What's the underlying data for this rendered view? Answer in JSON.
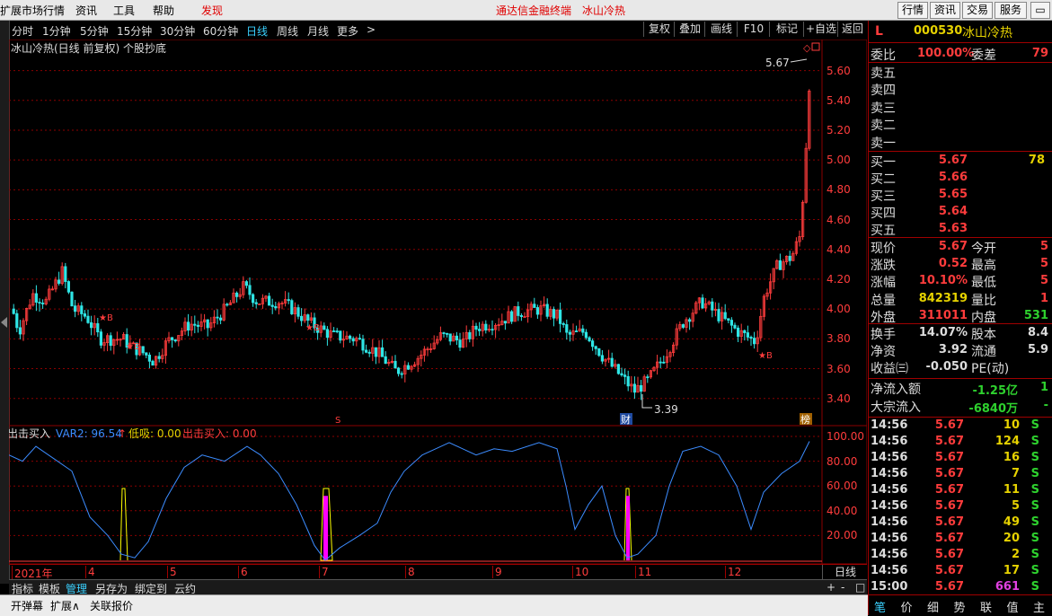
{
  "menu": {
    "items": [
      "扩展市场行情",
      "资讯",
      "工具",
      "帮助",
      "发现"
    ],
    "center_title": "通达信金融终端",
    "center_stock": "冰山冷热",
    "right_buttons": [
      "行情",
      "资讯",
      "交易",
      "服务"
    ]
  },
  "toolbar": {
    "periods": [
      "分时",
      "1分钟",
      "5分钟",
      "15分钟",
      "30分钟",
      "60分钟",
      "日线",
      "周线",
      "月线",
      "更多"
    ],
    "selected_period": "日线",
    "more_arrow": ">",
    "buttons": [
      "复权",
      "叠加",
      "画线",
      "F10",
      "标记",
      "+自选",
      "返回"
    ]
  },
  "main_chart": {
    "title": "冰山冷热(日线 前复权) 个股抄底",
    "high_label": "5.67",
    "low_label": "3.39",
    "marker_s": "S",
    "marker_cai": "财",
    "marker_bang": "榜",
    "b_signal": "B",
    "price_ticks": [
      "5.60",
      "5.40",
      "5.20",
      "5.00",
      "4.80",
      "4.60",
      "4.40",
      "4.20",
      "4.00",
      "3.80",
      "3.60",
      "3.40"
    ]
  },
  "indicator": {
    "name": "出击买入",
    "var2_label": "VAR2: 96.54",
    "low_label": "低吸: 0.00",
    "buy_label": "出击买入: 0.00",
    "ticks": [
      "100.00",
      "80.00",
      "60.00",
      "40.00",
      "20.00"
    ]
  },
  "x_axis": {
    "labels": [
      "2021年",
      "4",
      "5",
      "6",
      "7",
      "8",
      "9",
      "10",
      "11",
      "12"
    ],
    "period_label": "日线",
    "zoom_in": "+",
    "zoom_out": "-",
    "reset": "□"
  },
  "quote": {
    "flag": "L",
    "code": "000530",
    "name": "冰山冷热",
    "weibi_label": "委比",
    "weibi": "100.00%",
    "weicha_label": "委差",
    "weicha": "79",
    "sells": [
      {
        "label": "卖五"
      },
      {
        "label": "卖四"
      },
      {
        "label": "卖三"
      },
      {
        "label": "卖二"
      },
      {
        "label": "卖一"
      }
    ],
    "buys": [
      {
        "label": "买一",
        "price": "5.67",
        "vol": "78"
      },
      {
        "label": "买二",
        "price": "5.66",
        "vol": ""
      },
      {
        "label": "买三",
        "price": "5.65",
        "vol": ""
      },
      {
        "label": "买四",
        "price": "5.64",
        "vol": ""
      },
      {
        "label": "买五",
        "price": "5.63",
        "vol": ""
      }
    ],
    "stats": [
      {
        "l1": "现价",
        "v1": "5.67",
        "l2": "今开",
        "v2": "5",
        "c1": "#ff3c3c",
        "c2": "#ff3c3c"
      },
      {
        "l1": "涨跌",
        "v1": "0.52",
        "l2": "最高",
        "v2": "5",
        "c1": "#ff3c3c",
        "c2": "#ff3c3c"
      },
      {
        "l1": "涨幅",
        "v1": "10.10%",
        "l2": "最低",
        "v2": "5",
        "c1": "#ff3c3c",
        "c2": "#ff3c3c"
      },
      {
        "l1": "总量",
        "v1": "842319",
        "l2": "量比",
        "v2": "1",
        "c1": "#e6d200",
        "c2": "#ff3c3c"
      },
      {
        "l1": "外盘",
        "v1": "311011",
        "l2": "内盘",
        "v2": "531",
        "c1": "#ff3c3c",
        "c2": "#2ed12e"
      }
    ],
    "stats2": [
      {
        "l1": "换手",
        "v1": "14.07%",
        "l2": "股本",
        "v2": "8.4",
        "c1": "#ddd",
        "c2": "#ddd"
      },
      {
        "l1": "净资",
        "v1": "3.92",
        "l2": "流通",
        "v2": "5.9",
        "c1": "#ddd",
        "c2": "#ddd"
      },
      {
        "l1": "收益㈢",
        "v1": "-0.050",
        "l2": "PE(动)",
        "v2": "",
        "c1": "#ddd",
        "c2": "#ddd"
      }
    ],
    "flow": [
      {
        "label": "净流入额",
        "value": "-1.25亿",
        "extra": "1"
      },
      {
        "label": "大宗流入",
        "value": "-6840万",
        "extra": "-"
      }
    ],
    "ticks": [
      {
        "t": "14:56",
        "p": "5.67",
        "v": "10",
        "d": "S",
        "vc": "#e6d200"
      },
      {
        "t": "14:56",
        "p": "5.67",
        "v": "124",
        "d": "S",
        "vc": "#e6d200"
      },
      {
        "t": "14:56",
        "p": "5.67",
        "v": "16",
        "d": "S",
        "vc": "#e6d200"
      },
      {
        "t": "14:56",
        "p": "5.67",
        "v": "7",
        "d": "S",
        "vc": "#e6d200"
      },
      {
        "t": "14:56",
        "p": "5.67",
        "v": "11",
        "d": "S",
        "vc": "#e6d200"
      },
      {
        "t": "14:56",
        "p": "5.67",
        "v": "5",
        "d": "S",
        "vc": "#e6d200"
      },
      {
        "t": "14:56",
        "p": "5.67",
        "v": "49",
        "d": "S",
        "vc": "#e6d200"
      },
      {
        "t": "14:56",
        "p": "5.67",
        "v": "20",
        "d": "S",
        "vc": "#e6d200"
      },
      {
        "t": "14:56",
        "p": "5.67",
        "v": "2",
        "d": "S",
        "vc": "#e6d200"
      },
      {
        "t": "14:56",
        "p": "5.67",
        "v": "17",
        "d": "S",
        "vc": "#e6d200"
      },
      {
        "t": "15:00",
        "p": "5.67",
        "v": "661",
        "d": "S",
        "vc": "#e040e0"
      }
    ]
  },
  "bottom_tabs": [
    "指标",
    "模板",
    "管理",
    "另存为",
    "绑定到",
    "云约"
  ],
  "bottom_tab_selected": "管理",
  "status_items": [
    "开弹幕",
    "扩展∧",
    "关联报价"
  ],
  "right_tabs": [
    "笔",
    "价",
    "细",
    "势",
    "联",
    "值",
    "主"
  ],
  "right_tab_selected": "笔",
  "colors": {
    "up": "#ff3c3c",
    "down": "#2ee6e6",
    "grid": "#8b0000",
    "var2": "#3c8cff",
    "signal_yellow": "#ffff00",
    "signal_magenta": "#ff00ff"
  }
}
